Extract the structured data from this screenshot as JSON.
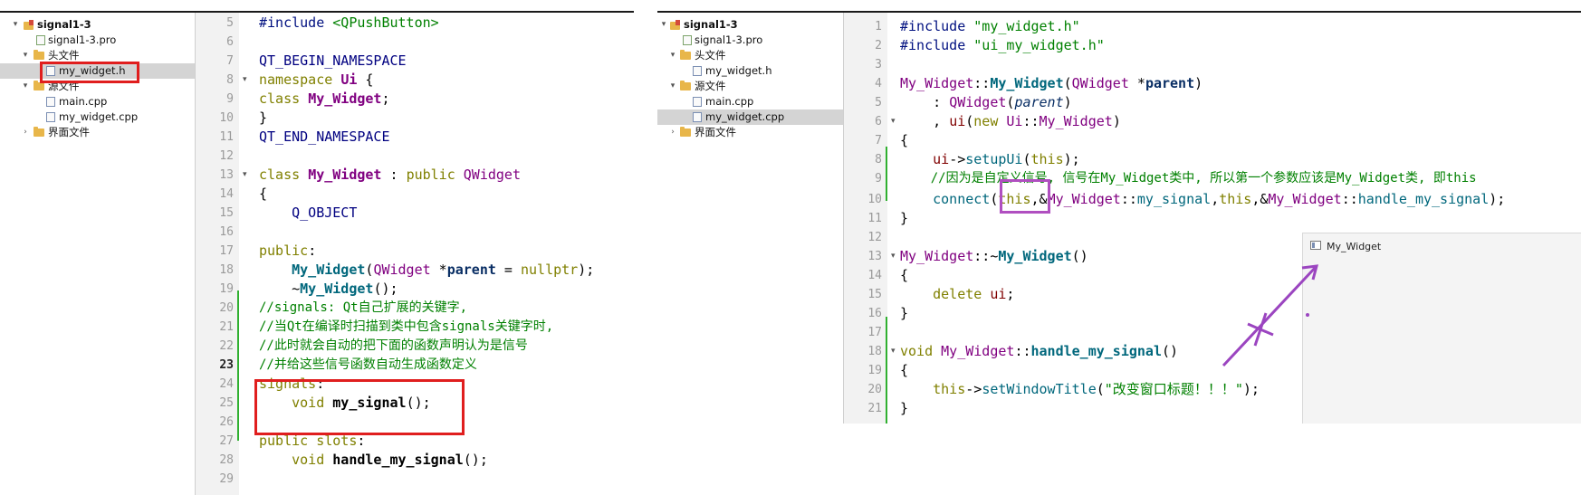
{
  "left": {
    "tree": {
      "project": "signal1-3",
      "pro_file": "signal1-3.pro",
      "headers_folder": "头文件",
      "header_file": "my_widget.h",
      "sources_folder": "源文件",
      "source_main": "main.cpp",
      "source_widget": "my_widget.cpp",
      "forms_folder": "界面文件"
    },
    "line_numbers": [
      "5",
      "6",
      "7",
      "8",
      "9",
      "10",
      "11",
      "12",
      "13",
      "14",
      "15",
      "16",
      "17",
      "18",
      "19",
      "20",
      "21",
      "22",
      "23",
      "24",
      "25",
      "26",
      "27",
      "28",
      "29"
    ],
    "code": {
      "l5a": "#include ",
      "l5b": "<QPushButton>",
      "l7": "QT_BEGIN_NAMESPACE",
      "l8a": "namespace ",
      "l8b": "Ui",
      "l8c": " {",
      "l9a": "class ",
      "l9b": "My_Widget",
      "l9c": ";",
      "l10": "}",
      "l11": "QT_END_NAMESPACE",
      "l13a": "class ",
      "l13b": "My_Widget",
      "l13c": " : ",
      "l13d": "public ",
      "l13e": "QWidget",
      "l14": "{",
      "l15": "    Q_OBJECT",
      "l17a": "public",
      "l17b": ":",
      "l18a": "    ",
      "l18b": "My_Widget",
      "l18c": "(",
      "l18d": "QWidget",
      "l18e": " *",
      "l18f": "parent",
      "l18g": " = ",
      "l18h": "nullptr",
      "l18i": ");",
      "l19a": "    ~",
      "l19b": "My_Widget",
      "l19c": "();",
      "l20": "//signals: Qt自己扩展的关键字,",
      "l21": "//当Qt在编译时扫描到类中包含signals关键字时,",
      "l22": "//此时就会自动的把下面的函数声明认为是信号",
      "l23": "//并给这些信号函数自动生成函数定义",
      "l24a": "signals",
      "l24b": ":",
      "l25a": "    ",
      "l25b": "void ",
      "l25c": "my_signal",
      "l25d": "();",
      "l27a": "public ",
      "l27b": "slots",
      "l27c": ":",
      "l28a": "    ",
      "l28b": "void ",
      "l28c": "handle_my_signal",
      "l28d": "();"
    }
  },
  "right": {
    "tree": {
      "project": "signal1-3",
      "pro_file": "signal1-3.pro",
      "headers_folder": "头文件",
      "header_file": "my_widget.h",
      "sources_folder": "源文件",
      "source_main": "main.cpp",
      "source_widget": "my_widget.cpp",
      "forms_folder": "界面文件"
    },
    "line_numbers": [
      "1",
      "2",
      "3",
      "4",
      "5",
      "6",
      "7",
      "8",
      "9",
      "10",
      "11",
      "12",
      "13",
      "14",
      "15",
      "16",
      "17",
      "18",
      "19",
      "20",
      "21"
    ],
    "code": {
      "l1a": "#include ",
      "l1b": "\"my_widget.h\"",
      "l2a": "#include ",
      "l2b": "\"ui_my_widget.h\"",
      "l4a": "My_Widget",
      "l4b": "::",
      "l4c": "My_Widget",
      "l4d": "(",
      "l4e": "QWidget",
      "l4f": " *",
      "l4g": "parent",
      "l4h": ")",
      "l5a": "    : ",
      "l5b": "QWidget",
      "l5c": "(",
      "l5d": "parent",
      "l5e": ")",
      "l6a": "    , ",
      "l6b": "ui",
      "l6c": "(",
      "l6d": "new ",
      "l6e": "Ui",
      "l6f": "::",
      "l6g": "My_Widget",
      "l6h": ")",
      "l7": "{",
      "l8a": "    ",
      "l8b": "ui",
      "l8c": "->",
      "l8d": "setupUi",
      "l8e": "(",
      "l8f": "this",
      "l8g": ");",
      "l9": "    //因为是自定义信号, 信号在My_Widget类中, 所以第一个参数应该是My_Widget类, 即this",
      "l10a": "    ",
      "l10b": "connect",
      "l10c": "(",
      "l10d": "this",
      "l10e": ",&",
      "l10f": "My_Widget",
      "l10g": "::",
      "l10h": "my_signal",
      "l10i": ",",
      "l10j": "this",
      "l10k": ",&",
      "l10l": "My_Widget",
      "l10m": "::",
      "l10n": "handle_my_signal",
      "l10o": ");",
      "l11": "}",
      "l13a": "My_Widget",
      "l13b": "::~",
      "l13c": "My_Widget",
      "l13d": "()",
      "l14": "{",
      "l15a": "    ",
      "l15b": "delete ",
      "l15c": "ui",
      "l15d": ";",
      "l16": "}",
      "l18a": "void ",
      "l18b": "My_Widget",
      "l18c": "::",
      "l18d": "handle_my_signal",
      "l18e": "()",
      "l19": "{",
      "l20a": "    ",
      "l20b": "this",
      "l20c": "->",
      "l20d": "setWindowTitle",
      "l20e": "(",
      "l20f": "\"改变窗口标题！！！\"",
      "l20g": ");",
      "l21": "}"
    },
    "popup_title": "My_Widget"
  },
  "colors": {
    "highlight_box": "#e01e1e",
    "connect_box": "#b04fc0",
    "annotation_arrow": "#9b45c0",
    "diff_marker": "#30b030"
  }
}
